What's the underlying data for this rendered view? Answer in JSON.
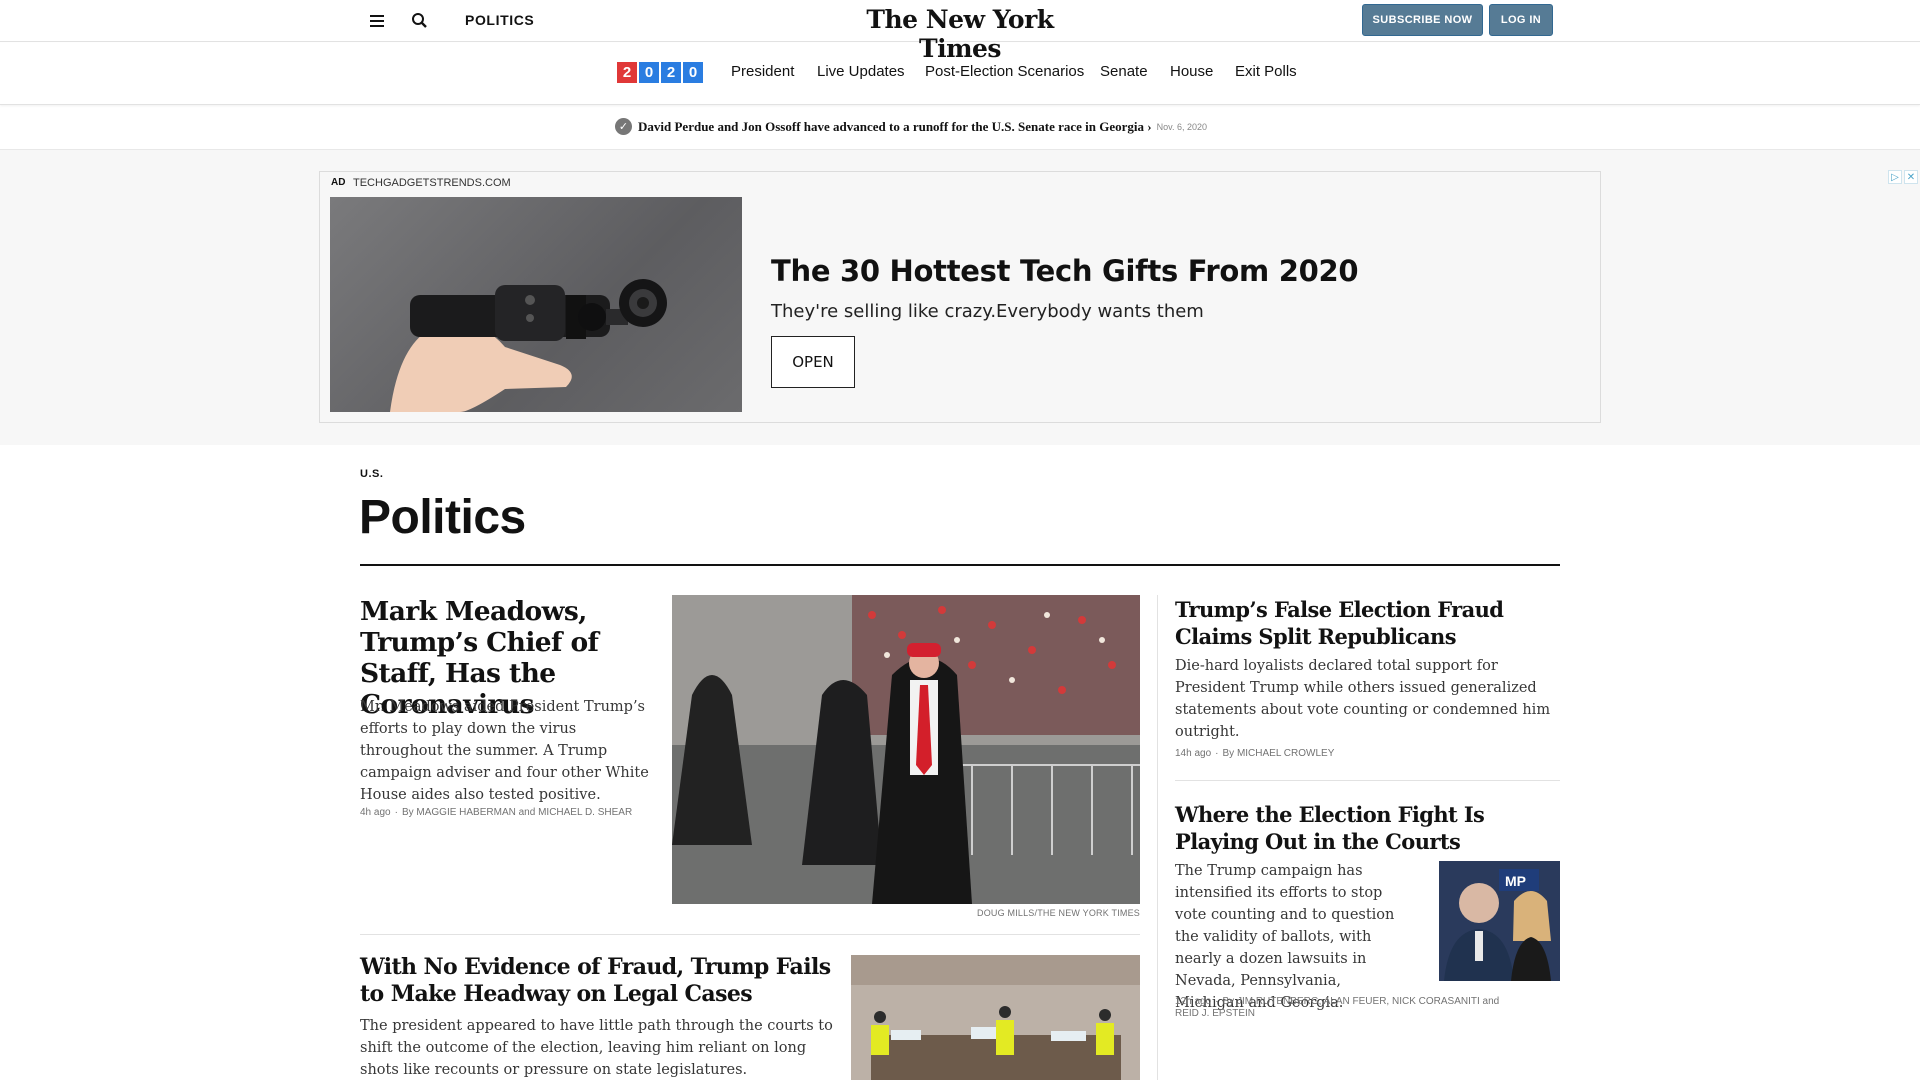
{
  "header": {
    "section_label": "POLITICS",
    "masthead": "The New York Times",
    "subscribe_label": "SUBSCRIBE NOW",
    "login_label": "LOG IN"
  },
  "election_nav": {
    "logo_digits": [
      "2",
      "0",
      "2",
      "0"
    ],
    "logo_colors": [
      "#e03838",
      "#2a7de1",
      "#2a7de1",
      "#2a7de1"
    ],
    "items": [
      "President",
      "Live Updates",
      "Post-Election Scenarios",
      "Senate",
      "House",
      "Exit Polls"
    ]
  },
  "alert": {
    "text": "David Perdue and Jon Ossoff have advanced to a runoff for the U.S. Senate race in Georgia ›",
    "date": "Nov. 6, 2020"
  },
  "ad": {
    "label": "AD",
    "domain": "TECHGADGETSTRENDS.COM",
    "title": "The 30 Hottest Tech Gifts From 2020",
    "subtitle": "They're selling like crazy.Everybody wants them",
    "cta": "OPEN"
  },
  "section": {
    "kicker": "U.S.",
    "title": "Politics"
  },
  "lead_story": {
    "headline": "Mark Meadows, Trump’s Chief of Staff, Has the Coronavirus",
    "summary": "Mr. Meadows aided President Trump’s efforts to play down the virus throughout the summer. A Trump campaign adviser and four other White House aides also tested positive.",
    "time": "4h ago",
    "byline": "By MAGGIE HABERMAN and MICHAEL D. SHEAR",
    "image_credit": "DOUG MILLS/THE NEW YORK TIMES"
  },
  "story2": {
    "headline": "With No Evidence of Fraud, Trump Fails to Make Headway on Legal Cases",
    "summary": "The president appeared to have little path through the courts to shift the outcome of the election, leaving him reliant on long shots like recounts or pressure on state legislatures."
  },
  "right_stories": [
    {
      "headline": "Trump’s False Election Fraud Claims Split Republicans",
      "summary": "Die-hard loyalists declared total support for President Trump while others issued generalized statements about vote counting or condemned him outright.",
      "time": "14h ago",
      "byline": "By MICHAEL CROWLEY"
    },
    {
      "headline": "Where the Election Fight Is Playing Out in the Courts",
      "summary": "The Trump campaign has intensified its efforts to stop vote counting and to question the validity of ballots, with nearly a dozen lawsuits in Nevada, Pennsylvania, Michigan and Georgia.",
      "time": "12h ago",
      "byline": "By JIM RUTENBERG, ALAN FEUER, NICK CORASANITI and REID J. EPSTEIN"
    }
  ],
  "icons": {
    "menu": "hamburger-menu-icon",
    "search": "magnifier-search-icon",
    "alert": "checkmark-icon",
    "ad_choices": "adchoices-icon",
    "ad_close": "close-icon"
  }
}
